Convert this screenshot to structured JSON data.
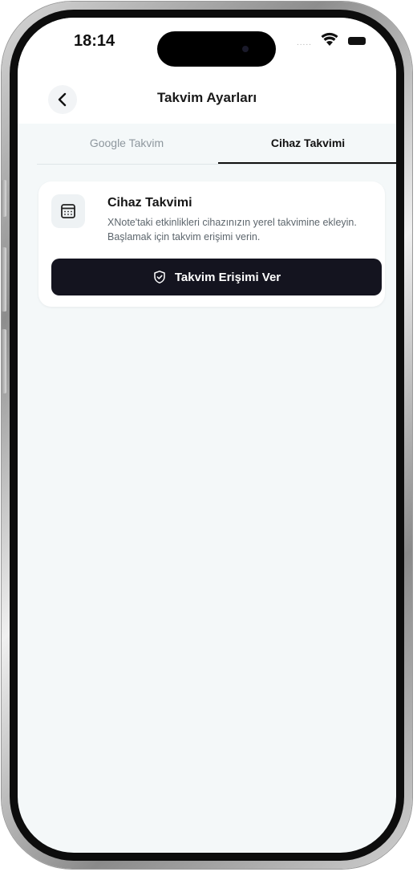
{
  "status_bar": {
    "time": "18:14",
    "signal_text": "....."
  },
  "header": {
    "title": "Takvim Ayarları",
    "back_icon": "chevron-left-icon"
  },
  "tabs": [
    {
      "label": "Google Takvim",
      "active": false
    },
    {
      "label": "Cihaz Takvimi",
      "active": true
    }
  ],
  "card": {
    "icon": "calendar-icon",
    "title": "Cihaz Takvimi",
    "description": "XNote'taki etkinlikleri cihazınızın yerel takvimine ekleyin. Başlamak için takvim erişimi verin.",
    "button_label": "Takvim Erişimi Ver",
    "button_icon": "shield-check-icon"
  },
  "colors": {
    "background": "#f4f8f9",
    "primary_button": "#14141f",
    "active_tab": "#111111",
    "inactive_tab": "#8e979e"
  }
}
